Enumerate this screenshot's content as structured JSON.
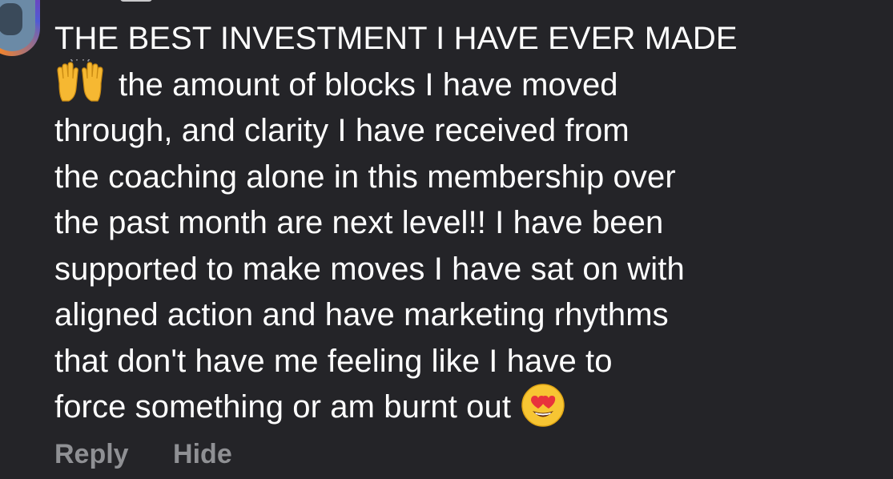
{
  "comment": {
    "lines": [
      "THE BEST INVESTMENT I HAVE EVER MADE",
      "the amount of blocks I have moved",
      "through, and clarity I have received from",
      "the coaching alone in this membership over",
      "the past month are next level!! I have been",
      "supported to make moves I have sat on with",
      "aligned action and have marketing rhythms",
      "that don't have me feeling like I have to",
      "force something or am burnt out"
    ],
    "emojis": [
      "raised-hands",
      "smiling-face-with-heart-eyes"
    ]
  },
  "actions": {
    "reply_label": "Reply",
    "hide_label": "Hide"
  },
  "colors": {
    "background": "#242428",
    "text": "#ffffff",
    "action_text": "#8f9094"
  }
}
